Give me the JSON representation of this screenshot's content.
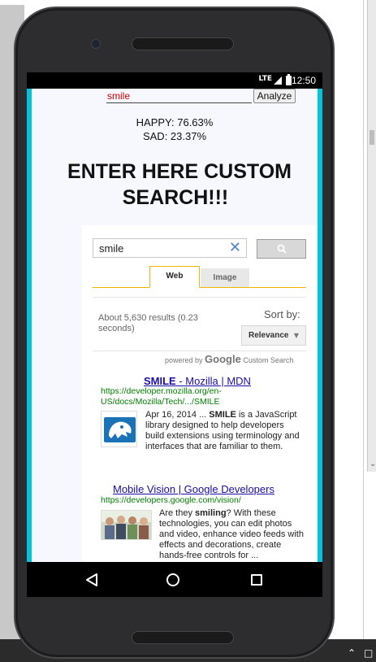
{
  "status_bar": {
    "network": "LTE",
    "time": "12:50"
  },
  "app": {
    "input_value": "smile",
    "analyze_label": "Analyze",
    "happy_text": "HAPPY: 76.63%",
    "sad_text": "SAD: 23.37%",
    "headline_line1": "ENTER HERE CUSTOM",
    "headline_line2": "SEARCH!!!"
  },
  "search_widget": {
    "query": "smile",
    "clear_glyph": "✕",
    "tabs": [
      {
        "label": "Web",
        "selected": true
      },
      {
        "label": "Image",
        "selected": false
      }
    ],
    "results_count": "About 5,630 results (0.23 seconds)",
    "sort_label": "Sort by:",
    "sort_value": "Relevance",
    "powered_by": "powered by",
    "google_brand": "Google",
    "custom_search": "Custom Search",
    "results": [
      {
        "title_bold": "SMILE",
        "title_rest": " - Mozilla | MDN",
        "url": "https://developer.mozilla.org/en-US/docs/Mozilla/Tech/.../SMILE",
        "snippet_date": "Apr 16, 2014 ...",
        "snippet_bold": "SMILE",
        "snippet_rest": " is a JavaScript library designed to help developers build extensions using terminology and interfaces that are familiar to them.",
        "thumb_icon": "mdn-logo-icon"
      },
      {
        "title": "Mobile Vision | Google Developers",
        "url": "https://developers.google.com/vision/",
        "snippet_pre": "Are they ",
        "snippet_bold": "smiling",
        "snippet_rest": "? With these technologies, you can edit photos and video, enhance video feeds with effects and decorations, create hands-free controls for ...",
        "thumb_icon": "people-photo-icon"
      }
    ]
  },
  "colors": {
    "accent_cyan": "#00c4dc",
    "tab_underline": "#f0b400",
    "link_blue": "#1a0dab",
    "url_green": "#008000",
    "input_text_red": "#d50000"
  }
}
